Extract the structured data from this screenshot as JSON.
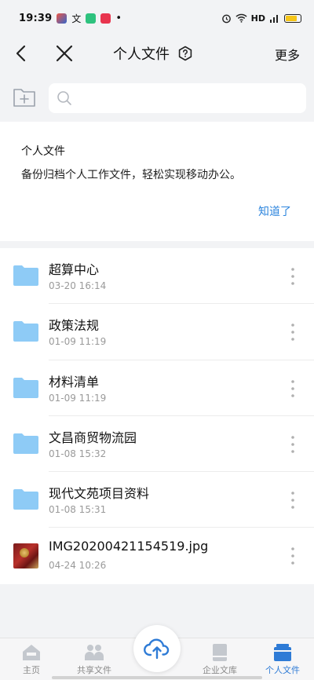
{
  "status_bar": {
    "time": "19:39",
    "signal_text": "HD",
    "dot": "•"
  },
  "nav": {
    "title": "个人文件",
    "more_label": "更多"
  },
  "search": {
    "placeholder": ""
  },
  "info_card": {
    "title": "个人文件",
    "description": "备份归档个人工作文件，轻松实现移动办公。",
    "ok_label": "知道了"
  },
  "files": [
    {
      "name": "超算中心",
      "date": "03-20 16:14",
      "type": "folder"
    },
    {
      "name": "政策法规",
      "date": "01-09 11:19",
      "type": "folder"
    },
    {
      "name": "材料清单",
      "date": "01-09 11:19",
      "type": "folder"
    },
    {
      "name": "文昌商贸物流园",
      "date": "01-08 15:32",
      "type": "folder"
    },
    {
      "name": "现代文苑项目资料",
      "date": "01-08 15:31",
      "type": "folder"
    },
    {
      "name": "IMG20200421154519.jpg",
      "date": "04-24 10:26",
      "type": "image"
    }
  ],
  "tabs": [
    {
      "label": "主页",
      "icon": "home-icon",
      "active": false
    },
    {
      "label": "共享文件",
      "icon": "shared-files-icon",
      "active": false
    },
    {
      "label": "企业文库",
      "icon": "enterprise-library-icon",
      "active": false
    },
    {
      "label": "个人文件",
      "icon": "personal-files-icon",
      "active": true
    }
  ],
  "colors": {
    "accent": "#2e7bd6",
    "folder": "#8ecbf6",
    "background": "#f2f3f5"
  }
}
